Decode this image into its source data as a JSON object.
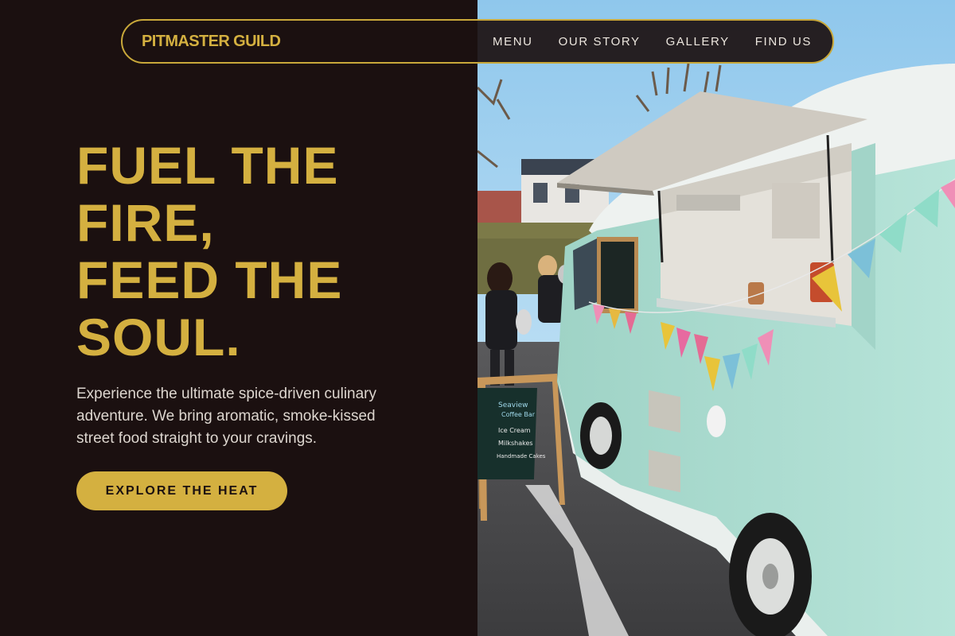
{
  "brand": {
    "name": "PITMASTER GUILD"
  },
  "nav": {
    "items": [
      {
        "label": "MENU"
      },
      {
        "label": "OUR STORY"
      },
      {
        "label": "GALLERY"
      },
      {
        "label": "FIND US"
      }
    ]
  },
  "hero": {
    "headline_lines": [
      "FUEL THE",
      "FIRE,",
      "FEED THE",
      "SOUL."
    ],
    "subtext": "Experience the ultimate spice-driven culinary adventure. We bring aromatic, smoke-kissed street food straight to your cravings.",
    "cta_label": "EXPLORE THE HEAT"
  },
  "photo": {
    "chalkboard_lines": [
      "Seaview",
      "Coffee Bar",
      "Ice Cream",
      "Milkshakes",
      "Handmade Cakes"
    ]
  },
  "colors": {
    "background": "#1b1010",
    "accent_gold": "#d4b040",
    "text_light": "#ece6de",
    "van_teal": "#a8dccf"
  }
}
